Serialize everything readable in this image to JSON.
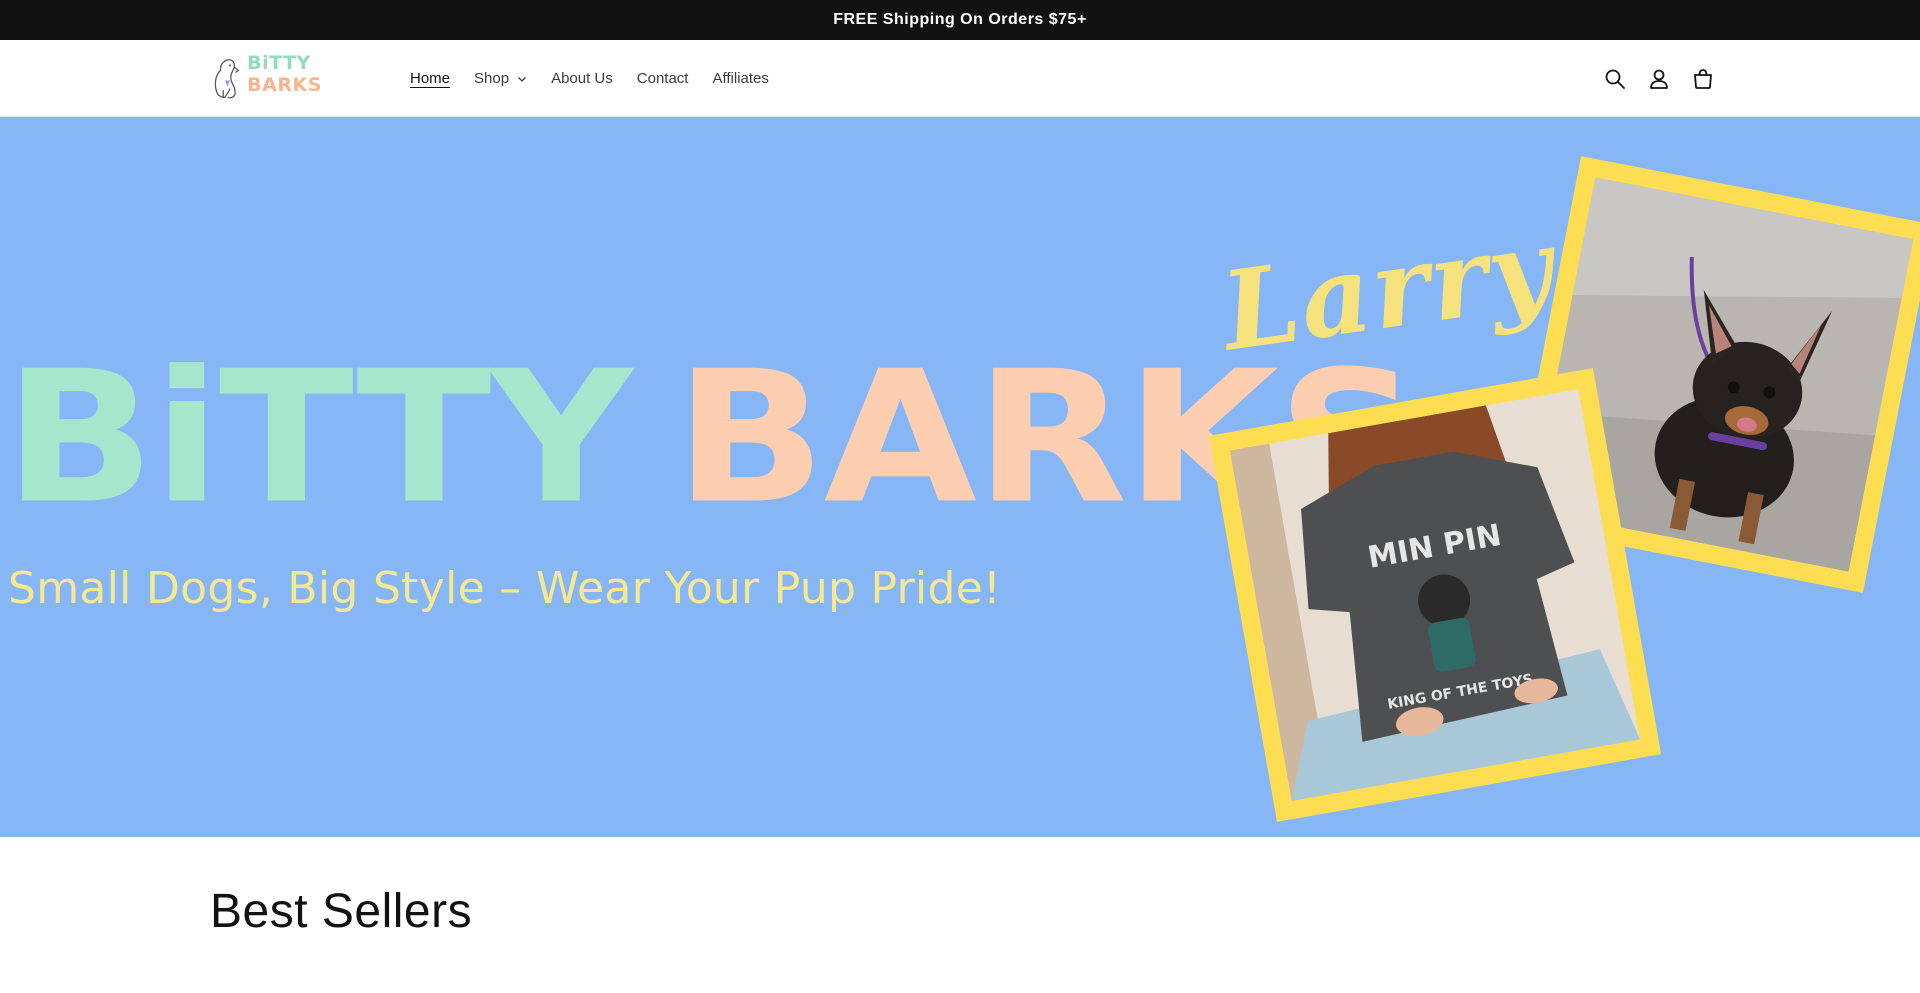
{
  "announcement": {
    "text": "FREE Shipping On Orders $75+"
  },
  "header": {
    "logo": {
      "word1": "BiTTY",
      "word2": "BARKS"
    },
    "nav": [
      {
        "label": "Home",
        "active": true
      },
      {
        "label": "Shop",
        "has_dropdown": true
      },
      {
        "label": "About Us"
      },
      {
        "label": "Contact"
      },
      {
        "label": "Affiliates"
      }
    ],
    "icons": [
      "search-icon",
      "account-icon",
      "cart-icon"
    ]
  },
  "hero": {
    "brand_word1": "BiTTY",
    "brand_word2": "BARKS",
    "tagline": "Small Dogs, Big Style – Wear Your Pup Pride!",
    "dog_name": "Larry",
    "shirt_text_top": "MIN PIN",
    "shirt_text_bottom": "KING OF THE TOYS",
    "colors": {
      "background": "#86b6f5",
      "mint": "#a5e6cd",
      "peach": "#fdceb0",
      "yellow": "#fdde52"
    }
  },
  "sections": {
    "best_sellers_title": "Best Sellers"
  }
}
